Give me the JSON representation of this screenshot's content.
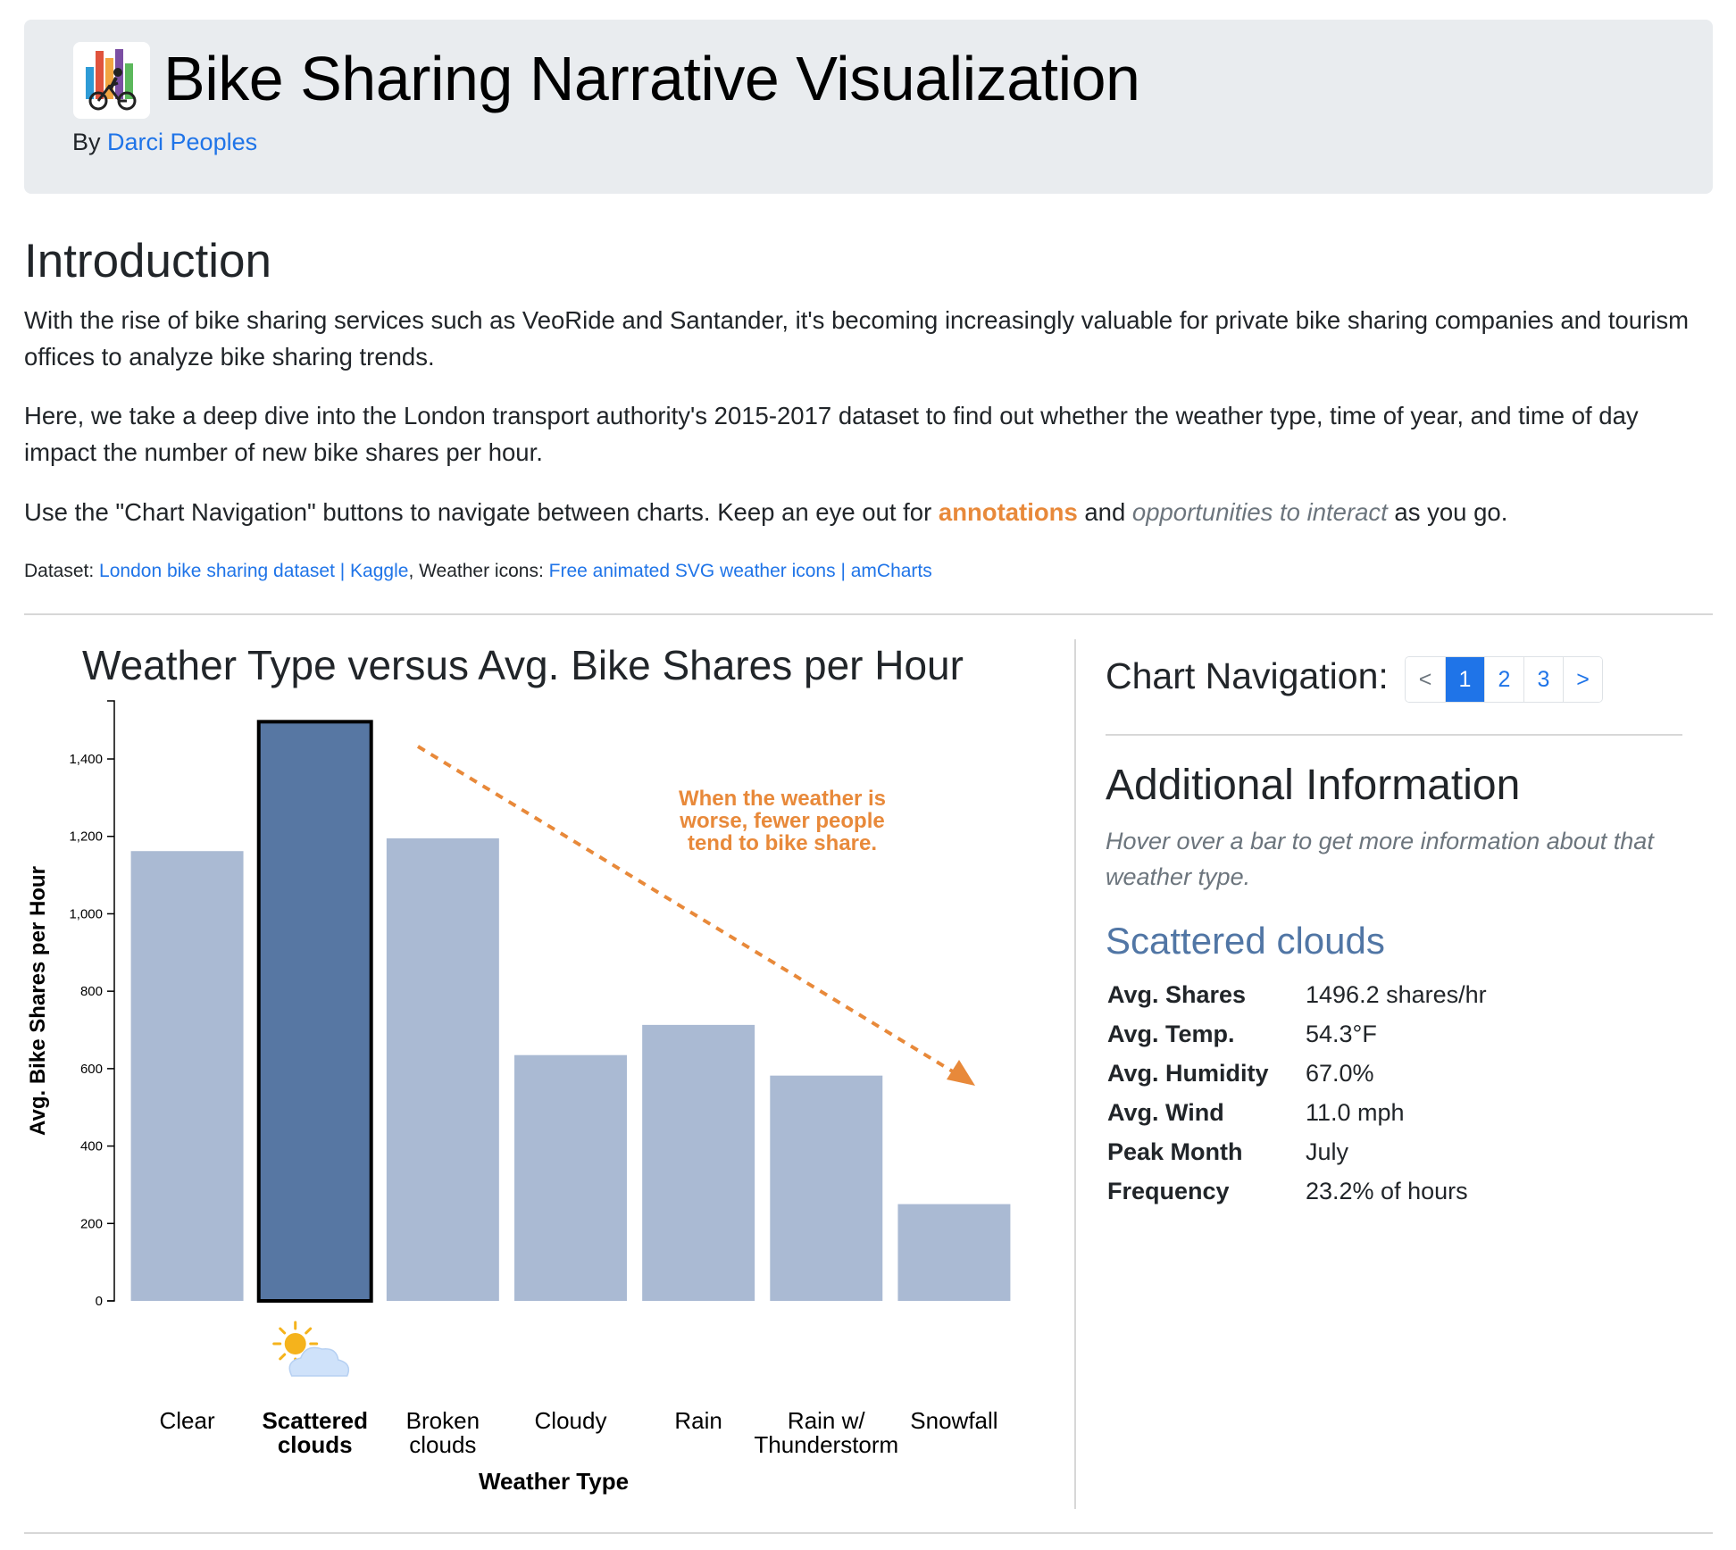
{
  "header": {
    "title": "Bike Sharing Narrative Visualization",
    "by_prefix": "By",
    "author": "Darci Peoples"
  },
  "intro": {
    "heading": "Introduction",
    "p1": "With the rise of bike sharing services such as VeoRide and Santander, it's becoming increasingly valuable for private bike sharing companies and tourism offices to analyze bike sharing trends.",
    "p2": "Here, we take a deep dive into the London transport authority's 2015-2017 dataset to find out whether the weather type, time of year, and time of day impact the number of new bike shares per hour.",
    "p3_before": "Use the \"Chart Navigation\" buttons to navigate between charts. Keep an eye out for ",
    "p3_annotations": "annotations",
    "p3_middle": " and ",
    "p3_interact": "opportunities to interact",
    "p3_after": " as you go."
  },
  "credits": {
    "dataset_label": "Dataset: ",
    "dataset_link": "London bike sharing dataset | Kaggle",
    "icons_label": ", Weather icons: ",
    "icons_link": "Free animated SVG weather icons | amCharts"
  },
  "navigation": {
    "label": "Chart Navigation:",
    "prev": "<",
    "pages": [
      "1",
      "2",
      "3"
    ],
    "next": ">",
    "active_page": "1"
  },
  "info": {
    "heading": "Additional Information",
    "hint": "Hover over a bar to get more information about that weather type.",
    "selected": "Scattered clouds",
    "rows": [
      {
        "key": "Avg. Shares",
        "value": "1496.2 shares/hr"
      },
      {
        "key": "Avg. Temp.",
        "value": "54.3°F"
      },
      {
        "key": "Avg. Humidity",
        "value": "67.0%"
      },
      {
        "key": "Avg. Wind",
        "value": "11.0 mph"
      },
      {
        "key": "Peak Month",
        "value": "July"
      },
      {
        "key": "Frequency",
        "value": "23.2% of hours"
      }
    ]
  },
  "chart_data": {
    "type": "bar",
    "title": "Weather Type versus Avg. Bike Shares per Hour",
    "xlabel": "Weather Type",
    "ylabel": "Avg. Bike Shares per Hour",
    "categories": [
      [
        "Clear"
      ],
      [
        "Scattered",
        "clouds"
      ],
      [
        "Broken",
        "clouds"
      ],
      [
        "Cloudy"
      ],
      [
        "Rain"
      ],
      [
        "Rain w/",
        "Thunderstorm"
      ],
      [
        "Snowfall"
      ]
    ],
    "values": [
      1162,
      1496.2,
      1195,
      635,
      713,
      582,
      250
    ],
    "highlighted_index": 1,
    "ylim": [
      0,
      1550
    ],
    "yticks": [
      0,
      200,
      400,
      600,
      800,
      1000,
      1200,
      1400
    ],
    "annotation": [
      "When the weather is",
      "worse, fewer people",
      "tend to bike share."
    ],
    "colors": {
      "bar": "#aabad3",
      "highlight": "#5777a3",
      "annotation": "#e8893a"
    },
    "highlight_icon": "sun-behind-cloud-icon"
  }
}
